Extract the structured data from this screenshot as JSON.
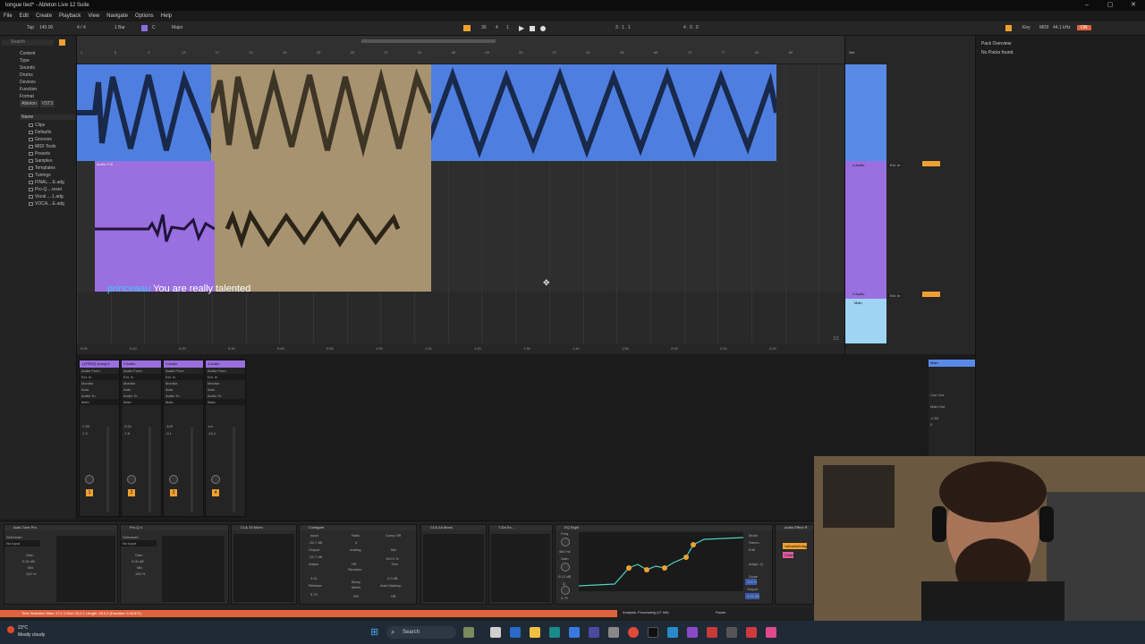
{
  "window": {
    "title": "tongue tied* - Ableton Live 12 Suite"
  },
  "menu": [
    "File",
    "Edit",
    "Create",
    "Playback",
    "View",
    "Navigate",
    "Options",
    "Help"
  ],
  "transport": {
    "tap": "Tap",
    "tempo": "140.00",
    "sig": "4 / 4",
    "quant": "1 Bar",
    "key": "C",
    "scale": "Major",
    "bars": "30",
    "beat": "4",
    "sub": "1",
    "pos": "3 . 1 . 1",
    "end": "4 . 0 . 0",
    "key_label": "Key",
    "midi_label": "MIDI",
    "sr": "44.1 kHz",
    "cpu": "ON"
  },
  "browser": {
    "search_placeholder": "Search",
    "categories": [
      "Content",
      "Type",
      "Sounds",
      "Drums",
      "Devices",
      "Function",
      "Format",
      "Ableton",
      "VST3"
    ],
    "section": "Name",
    "places": [
      "Clips",
      "Defaults",
      "Grooves",
      "MIDI Tools",
      "Presets",
      "Samples",
      "Templates",
      "Tunings",
      "FINAL....E.adg",
      "Pro-Q....reset",
      "Vocal ....1.adg",
      "VOCA....E.adg"
    ]
  },
  "ruler": [
    "1",
    "5",
    "9",
    "13",
    "17",
    "21",
    "25",
    "29",
    "33",
    "37",
    "41",
    "45",
    "49",
    "53",
    "57",
    "61",
    "65",
    "69",
    "73",
    "77",
    "81",
    "85"
  ],
  "timeline": [
    "0:00",
    "0:10",
    "0:20",
    "0:30",
    "0:40",
    "0:50",
    "1:00",
    "1:10",
    "1:20",
    "1:30",
    "1:40",
    "1:50",
    "2:00",
    "2:10",
    "2:20"
  ],
  "caption": {
    "user": "princeaau",
    "text": "You are really talented"
  },
  "clips": {
    "audio2": "Audio 278"
  },
  "tracks": {
    "headers": [
      "Set",
      "2 Audio",
      "3 Audio",
      "Main"
    ],
    "io_in": "Ext. In",
    "page": "1/1"
  },
  "mixer": {
    "strips": [
      {
        "name": "1 [FREE] young b",
        "num": "1",
        "vol": "-7.50",
        "pan": "-7.2"
      },
      {
        "name": "2 Audio",
        "num": "2",
        "vol": "-9.31",
        "pan": "-7.8"
      },
      {
        "name": "3 Audio",
        "num": "3",
        "vol": "-109",
        "pan": "-9.1"
      },
      {
        "name": "4 Audio",
        "num": "4",
        "vol": "-inf",
        "pan": "-14.2"
      }
    ],
    "labels": {
      "audio_from": "Audio From",
      "ext_in": "Ext. In",
      "monitor": "Monitor",
      "audio_to": "Audio To",
      "main": "Main",
      "in": "In",
      "auto": "Auto",
      "off": "Off"
    },
    "main": {
      "name": "Main",
      "cue_out": "Cue Out",
      "main_out": "Main Out",
      "vol": "-2.83",
      "pan": "0"
    }
  },
  "rightpanel": {
    "title": "Pack Overview",
    "empty": "No Packs found."
  },
  "devices": [
    {
      "title": "Auto-Tune Pro",
      "sidechain": "Sidechain",
      "noinput": "No Input",
      "gain": "Gain",
      "gain_val": "0.00 dB",
      "mix": "Mix",
      "mix_val": "100 %"
    },
    {
      "title": "Pro-Q 4",
      "sidechain": "Sidechain",
      "noinput": "No Input",
      "gain": "Gain",
      "gain_val": "0.00 dB",
      "mix": "Mix",
      "mix_val": "100 %"
    },
    {
      "title": "CLA-76 Mono"
    },
    {
      "title": "Configure",
      "input": "Input",
      "input_val": "-32.7 dB",
      "output": "Output",
      "output_val": "-22.7 dB",
      "attack": "Attack",
      "attack_val": "4.01",
      "release": "Release",
      "release_val": "5.73",
      "ratio": "Ratio",
      "ratio_val": "4",
      "analog": "Analog",
      "revision": "Revision",
      "bluey": "Bluey",
      "meter": "Meter",
      "gr": "GR",
      "comp": "Comp Off",
      "mix": "Mix",
      "mix_val": "100.0 %",
      "trim": "Trim",
      "trim_val": "0.0 dB",
      "makeup": "Auto Makeup",
      "off": "Off"
    },
    {
      "title": "CLA-2A Mono"
    },
    {
      "title": "T-De-Es..."
    },
    {
      "title": "EQ Eight",
      "freq": "Freq",
      "freq_val": "460 Hz",
      "gain": "Gain",
      "gain_val": "-6.12 dB",
      "q": "Q",
      "q_val": "0.79",
      "mode": "Mode",
      "stereo": "Stereo",
      "edit": "Edit",
      "adapt": "Adapt. Q",
      "scale": "Scale",
      "scale_val": "100 %",
      "output": "Output",
      "output_val": "0.00 dB"
    },
    {
      "title": "Audio Effect R",
      "chain": "ValhallaVintag",
      "chain2": "Chain"
    }
  ],
  "status": {
    "selection": "Time Selection  Start: 17.1.1  End: 43.2.1  Length: 26.0.0  (Duration: 0:44.571)",
    "analysis": "Analysis: Processing (27 left)",
    "pause": "Pause"
  },
  "taskbar": {
    "temp": "23°C",
    "weather": "Mostly cloudy",
    "search": "Search"
  }
}
